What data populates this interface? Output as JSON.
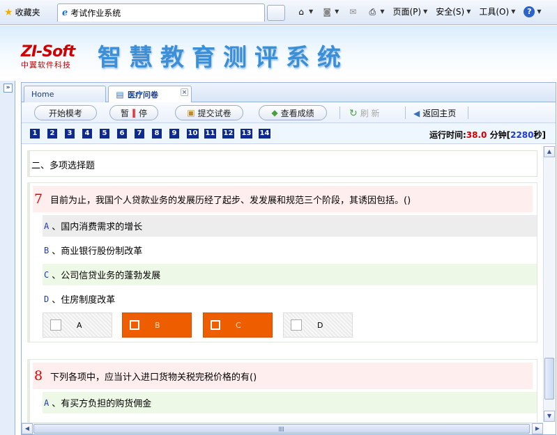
{
  "browser": {
    "favorites_label": "收藏夹",
    "tab_title": "考试作业系统",
    "page_menu": "页面(P)",
    "safety_menu": "安全(S)",
    "tools_menu": "工具(O)",
    "help_symbol": "?"
  },
  "header": {
    "logo_main": "ZI-Soft",
    "logo_sub": "中翼软件科技",
    "system_title": "智慧教育测评系统"
  },
  "tabs": [
    {
      "label": "Home"
    },
    {
      "label": "医疗问卷"
    }
  ],
  "toolbar": {
    "start_mock": "开始模考",
    "pause_a": "暂",
    "pause_b": "停",
    "submit": "提交试卷",
    "view_score": "查看成绩",
    "refresh": "刷 新",
    "back_home": "返回主页"
  },
  "question_nav": {
    "numbers": [
      "1",
      "2",
      "3",
      "4",
      "5",
      "6",
      "7",
      "8",
      "9",
      "10",
      "11",
      "12",
      "13",
      "14"
    ]
  },
  "timer": {
    "label": "运行时间:",
    "minutes": "38.0",
    "minutes_unit": "分钟[",
    "seconds": "2280",
    "seconds_unit": "秒]"
  },
  "section_title": "二、多项选择题",
  "questions": [
    {
      "number": "7",
      "text": "目前为止，我国个人贷款业务的发展历经了起步、发发展和规范三个阶段，其诱因包括。()",
      "options": [
        {
          "letter": "A",
          "text": "、国内消费需求的增长"
        },
        {
          "letter": "B",
          "text": "、商业银行股份制改革"
        },
        {
          "letter": "C",
          "text": "、公司信贷业务的蓬勃发展"
        },
        {
          "letter": "D",
          "text": "、住房制度改革"
        }
      ],
      "answers": [
        {
          "letter": "A",
          "checked": false
        },
        {
          "letter": "B",
          "checked": true
        },
        {
          "letter": "C",
          "checked": true
        },
        {
          "letter": "D",
          "checked": false
        }
      ]
    },
    {
      "number": "8",
      "text": "下列各项中，应当计入进口货物关税完税价格的有()",
      "options": [
        {
          "letter": "A",
          "text": "、有买方负担的购货佣金"
        }
      ]
    }
  ],
  "colors": {
    "selected_answer": "#ee5e00",
    "question_number": "#e00000",
    "nav_box": "#0d2a8c"
  }
}
